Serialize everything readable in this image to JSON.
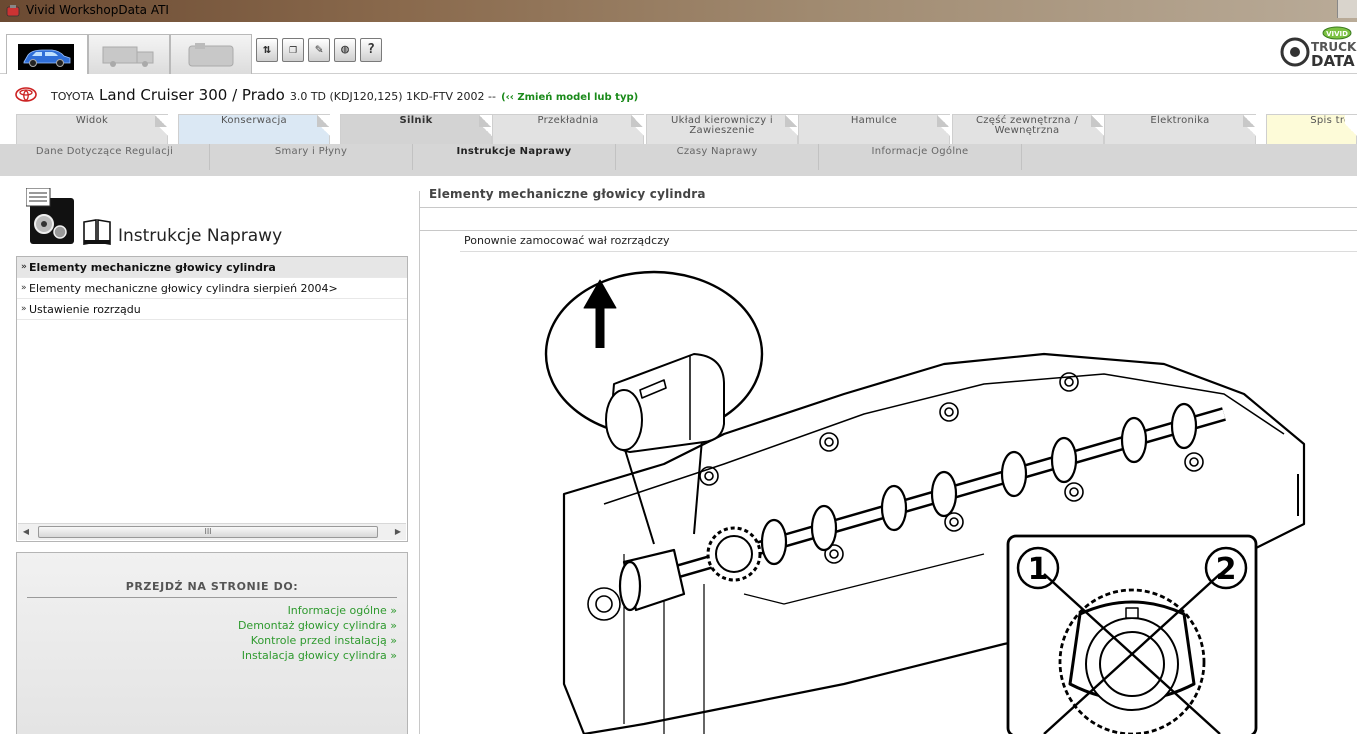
{
  "window": {
    "title": "Vivid WorkshopData ATI"
  },
  "toolbar": {
    "big_tabs": [
      {
        "icon": "car-icon"
      },
      {
        "icon": "truck-icon"
      },
      {
        "icon": "engine-icon"
      }
    ],
    "tools": [
      {
        "icon": "sort-icon",
        "glyph": "⇅"
      },
      {
        "icon": "copy-icon",
        "glyph": "❐"
      },
      {
        "icon": "edit-icon",
        "glyph": "✎"
      },
      {
        "icon": "globe-icon",
        "glyph": "◍"
      },
      {
        "icon": "help-icon",
        "glyph": "?"
      }
    ],
    "brand": {
      "top": "TRUCK",
      "bottom": "DATA",
      "badge": "VIVID"
    }
  },
  "vehicle": {
    "make": "TOYOTA",
    "model": "Land Cruiser 300 / Prado",
    "spec": "3.0 TD (KDJ120,125) 1KD-FTV 2002 --",
    "change_link": "(‹‹ Zmień model lub typ)"
  },
  "main_tabs": [
    {
      "label": "Widok"
    },
    {
      "label": "Konserwacja"
    },
    {
      "label": "Silnik"
    },
    {
      "label": "Przekładnia"
    },
    {
      "label": "Układ kierowniczy i Zawieszenie"
    },
    {
      "label": "Hamulce"
    },
    {
      "label": "Część zewnętrzna / Wewnętrzna"
    },
    {
      "label": "Elektronika"
    },
    {
      "label": "Spis treś"
    }
  ],
  "sub_tabs": [
    {
      "label": "Dane Dotyczące Regulacji"
    },
    {
      "label": "Smary i Płyny"
    },
    {
      "label": "Instrukcje Naprawy"
    },
    {
      "label": "Czasy Naprawy"
    },
    {
      "label": "Informacje Ogólne"
    }
  ],
  "left": {
    "heading": "Instrukcje Naprawy",
    "doc_items": [
      {
        "label": "Elementy mechaniczne głowicy cylindra"
      },
      {
        "label": "Elementy mechaniczne głowicy cylindra sierpień 2004>"
      },
      {
        "label": "Ustawienie rozrządu"
      }
    ],
    "scroll_grip": "III",
    "goto_title": "PRZEJDŹ NA STRONIE DO:",
    "goto_links": [
      {
        "label": "Informacje ogólne »"
      },
      {
        "label": "Demontaż głowicy cylindra »"
      },
      {
        "label": "Kontrole przed instalacją »"
      },
      {
        "label": "Instalacja głowicy cylindra »"
      }
    ]
  },
  "content": {
    "doc_title": "Elementy mechaniczne głowicy cylindra",
    "step_text": "Ponownie zamocować wał rozrządczy",
    "figure_labels": {
      "one": "1",
      "two": "2"
    }
  }
}
